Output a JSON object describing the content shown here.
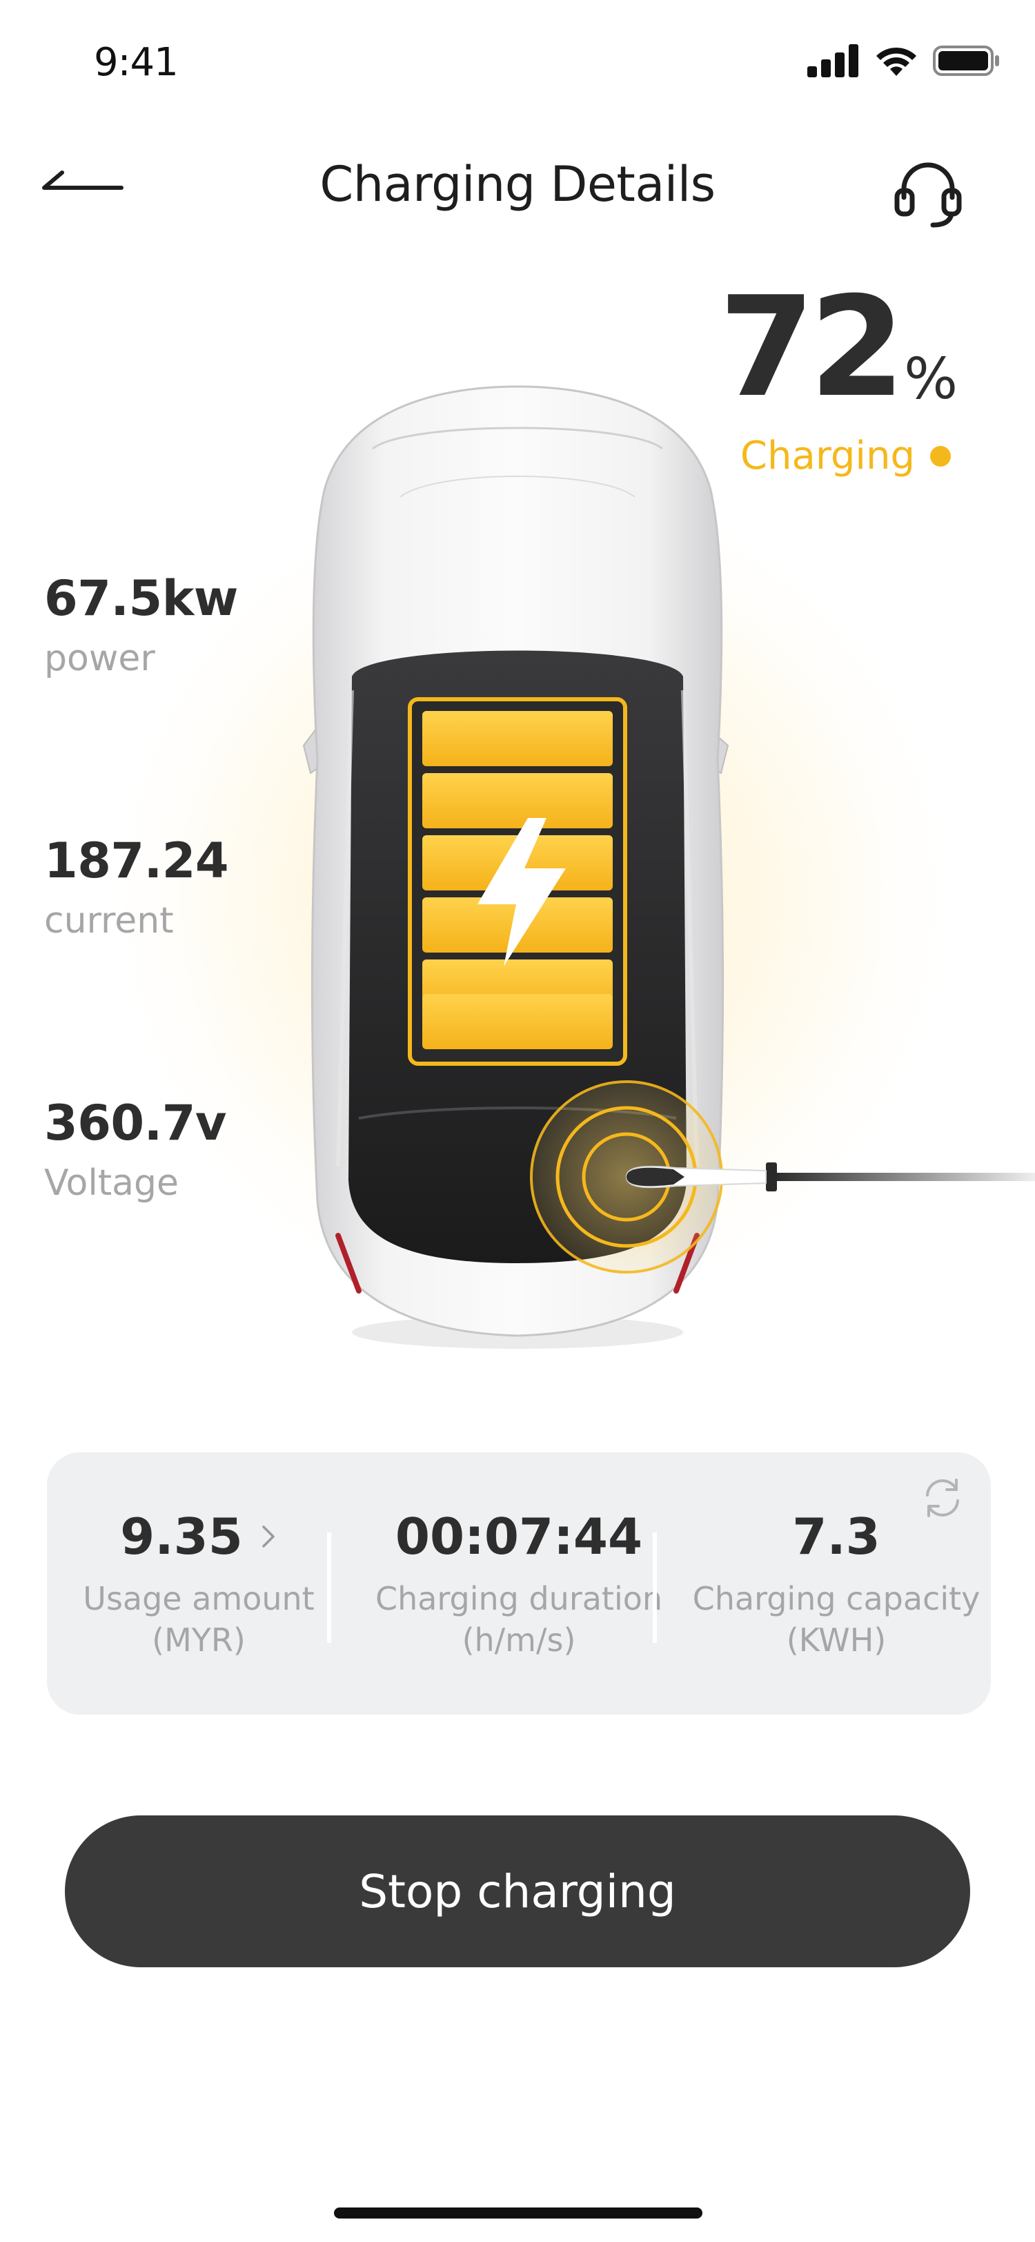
{
  "status_bar": {
    "time": "9:41",
    "icons": [
      "cellular-signal-icon",
      "wifi-icon",
      "battery-icon"
    ]
  },
  "header": {
    "title": "Charging Details",
    "back_icon": "back-arrow-icon",
    "support_icon": "headset-icon"
  },
  "battery": {
    "percent": "72",
    "unit": "%",
    "status": "Charging",
    "level": 0.72
  },
  "metrics": [
    {
      "value": "67.5kw",
      "label": "power"
    },
    {
      "value": "187.24",
      "label": "current"
    },
    {
      "value": "360.7v",
      "label": "Voltage"
    }
  ],
  "stats": [
    {
      "value": "9.35",
      "label": "Usage amount",
      "unit": "(MYR)"
    },
    {
      "value": "00:07:44",
      "label": "Charging duration",
      "unit": "(h/m/s)"
    },
    {
      "value": "7.3",
      "label": "Charging capacity",
      "unit": "(KWH)"
    }
  ],
  "action": {
    "stop_label": "Stop charging"
  },
  "colors": {
    "accent": "#f5b81c",
    "text_primary": "#2e2e2e",
    "text_secondary": "#a6a6a6",
    "card_bg": "#eff0f2",
    "button_bg": "#3a3a3a"
  }
}
